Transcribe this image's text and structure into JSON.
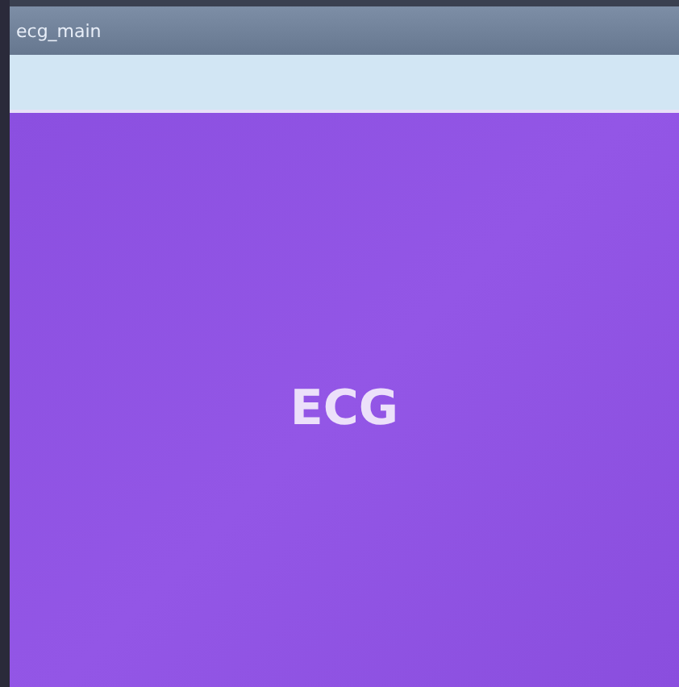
{
  "window": {
    "title": "ecg_main"
  },
  "screen": {
    "label": "ECG"
  }
}
